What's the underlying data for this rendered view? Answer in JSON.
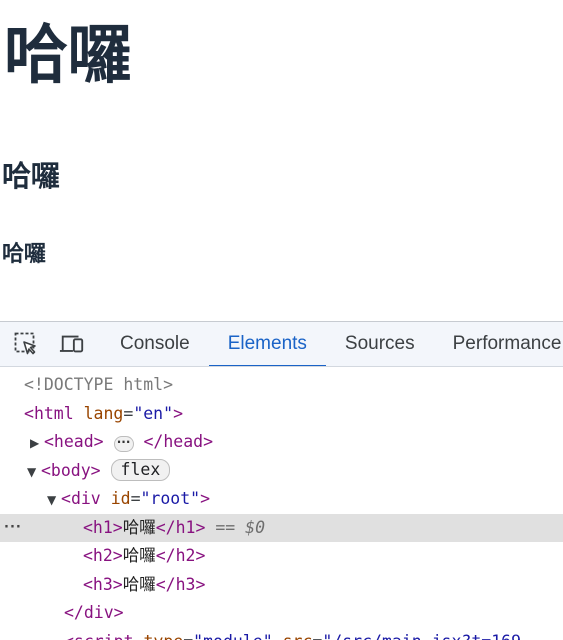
{
  "content": {
    "h1_text": "哈囉",
    "h2_text": "哈囉",
    "h3_text": "哈囉"
  },
  "devtools": {
    "toolbar": {
      "inspect_icon": "select-element-icon",
      "device_icon": "device-toolbar-icon",
      "tabs": [
        {
          "label": "Console",
          "active": false
        },
        {
          "label": "Elements",
          "active": true
        },
        {
          "label": "Sources",
          "active": false
        },
        {
          "label": "Performance",
          "active": false
        }
      ]
    },
    "tree": {
      "doctype": "<!DOCTYPE html>",
      "html_tag": "html",
      "html_attr_name": "lang",
      "html_attr_value": "\"en\"",
      "head_open": "<head>",
      "head_close": "</head>",
      "body_open": "<body",
      "body_badge": "flex",
      "div_tag": "div",
      "div_attr_name": "id",
      "div_attr_value": "\"root\"",
      "h1_open": "<h1>",
      "h1_text": "哈囉",
      "h1_close": "</h1>",
      "selected_ref": "== $0",
      "h2_open": "<h2>",
      "h2_text": "哈囉",
      "h2_close": "</h2>",
      "h3_open": "<h3>",
      "h3_text": "哈囉",
      "h3_close": "</h3>",
      "div_close": "</div>",
      "script_partial_tag": "<script",
      "script_attr_type": "type",
      "script_type_value": "\"module\"",
      "script_attr_src": "src",
      "script_src_value": "\"/src/main.jsx?t=169"
    },
    "colors": {
      "accent": "#1a63c7",
      "tag": "#881280",
      "attr": "#994500",
      "value": "#1a1aa6",
      "selected_row_bg": "#e0e0e0"
    }
  }
}
